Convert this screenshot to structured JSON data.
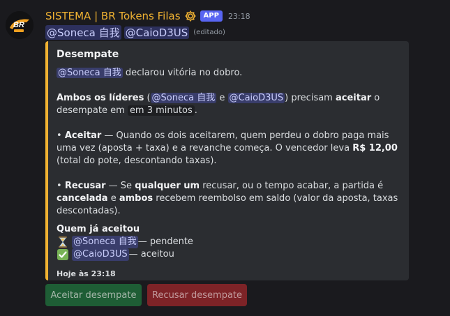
{
  "header": {
    "username": "SISTEMA | BR Tokens Filas",
    "badge": "APP",
    "time": "23:18"
  },
  "mentions": {
    "first": "@Soneca 自我",
    "second": "@CaioD3US",
    "edited": "(editado)"
  },
  "embed": {
    "accent_color": "#f0b232",
    "title": "Desempate",
    "line1": {
      "mention": "@Soneca 自我",
      "text": " declarou vitória no dobro."
    },
    "line2": {
      "bold1": "Ambos os líderes",
      "open": " (",
      "mention1": "@Soneca 自我",
      "and": " e ",
      "mention2": "@CaioD3US",
      "close": ") precisam ",
      "bold2": "aceitar",
      "rest": " o desempate em ",
      "code": "em 3 minutos",
      "end": "."
    },
    "line3": {
      "prefix": "• ",
      "bold": "Aceitar",
      "text1": " — Quando os dois aceitarem, quem perdeu o dobro paga mais uma vez (aposta + taxa) e a revanche começa. O vencedor leva ",
      "bold_value": "R$ 12,00",
      "text2": " (total do pote, descontando taxas)."
    },
    "line4": {
      "prefix": "• ",
      "bold": "Recusar",
      "text1": " — Se ",
      "bold2": "qualquer um",
      "text2": " recusar, ou o tempo acabar, a partida é ",
      "bold3": "cancelada",
      "text3": " e ",
      "bold4": "ambos",
      "text4": " recebem reembolso em saldo (valor da aposta, taxas descontadas)."
    },
    "field_name": "Quem já aceitou",
    "status": [
      {
        "icon": "hourglass-icon",
        "mention": "@Soneca 自我",
        "text": " — pendente"
      },
      {
        "icon": "check-mark-icon",
        "mention": "@CaioD3US",
        "text": " — aceitou"
      }
    ],
    "footer": "Hoje às 23:18"
  },
  "buttons": {
    "accept": "Aceitar desempate",
    "decline": "Recusar desempate"
  }
}
